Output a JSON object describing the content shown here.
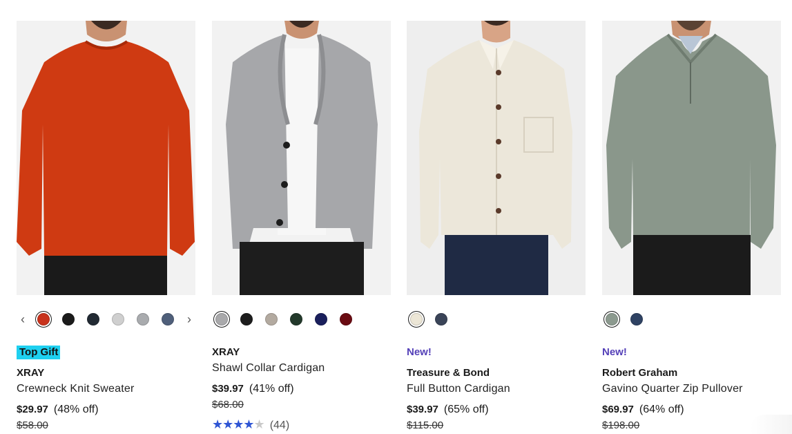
{
  "products": [
    {
      "badge": "Top Gift",
      "brand": "XRAY",
      "name": "Crewneck Knit Sweater",
      "price": "$29.97",
      "discount": "(48% off)",
      "original_price": "$58.00",
      "swatch_colors": [
        "#c8321c",
        "#1b1b1b",
        "#222a33",
        "#cfcfcf",
        "#a9abae",
        "#4f5f7a"
      ],
      "selected_swatch": 0,
      "image_desc": "orange-crewneck-sweater"
    },
    {
      "brand": "XRAY",
      "name": "Shawl Collar Cardigan",
      "price": "$39.97",
      "discount": "(41% off)",
      "original_price": "$68.00",
      "rating": 4.5,
      "review_count": "(44)",
      "swatch_colors": [
        "#a9a9ab",
        "#1d1d1d",
        "#b3aaa0",
        "#23392b",
        "#1a1f5c",
        "#6a0b12"
      ],
      "selected_swatch": 0,
      "image_desc": "gray-shawl-cardigan"
    },
    {
      "badge": "New!",
      "brand": "Treasure & Bond",
      "name": "Full Button Cardigan",
      "price": "$39.97",
      "discount": "(65% off)",
      "original_price": "$115.00",
      "swatch_colors": [
        "#ece6d6",
        "#3a4458"
      ],
      "selected_swatch": 0,
      "image_desc": "cream-button-cardigan"
    },
    {
      "badge": "New!",
      "brand": "Robert Graham",
      "name": "Gavino Quarter Zip Pullover",
      "price": "$69.97",
      "discount": "(64% off)",
      "original_price": "$198.00",
      "swatch_colors": [
        "#8c9a8f",
        "#2f4263"
      ],
      "selected_swatch": 0,
      "image_desc": "green-quarter-zip-pullover"
    }
  ],
  "icons": {
    "prev": "chevron-left-icon",
    "next": "chevron-right-icon",
    "star": "star-icon"
  }
}
